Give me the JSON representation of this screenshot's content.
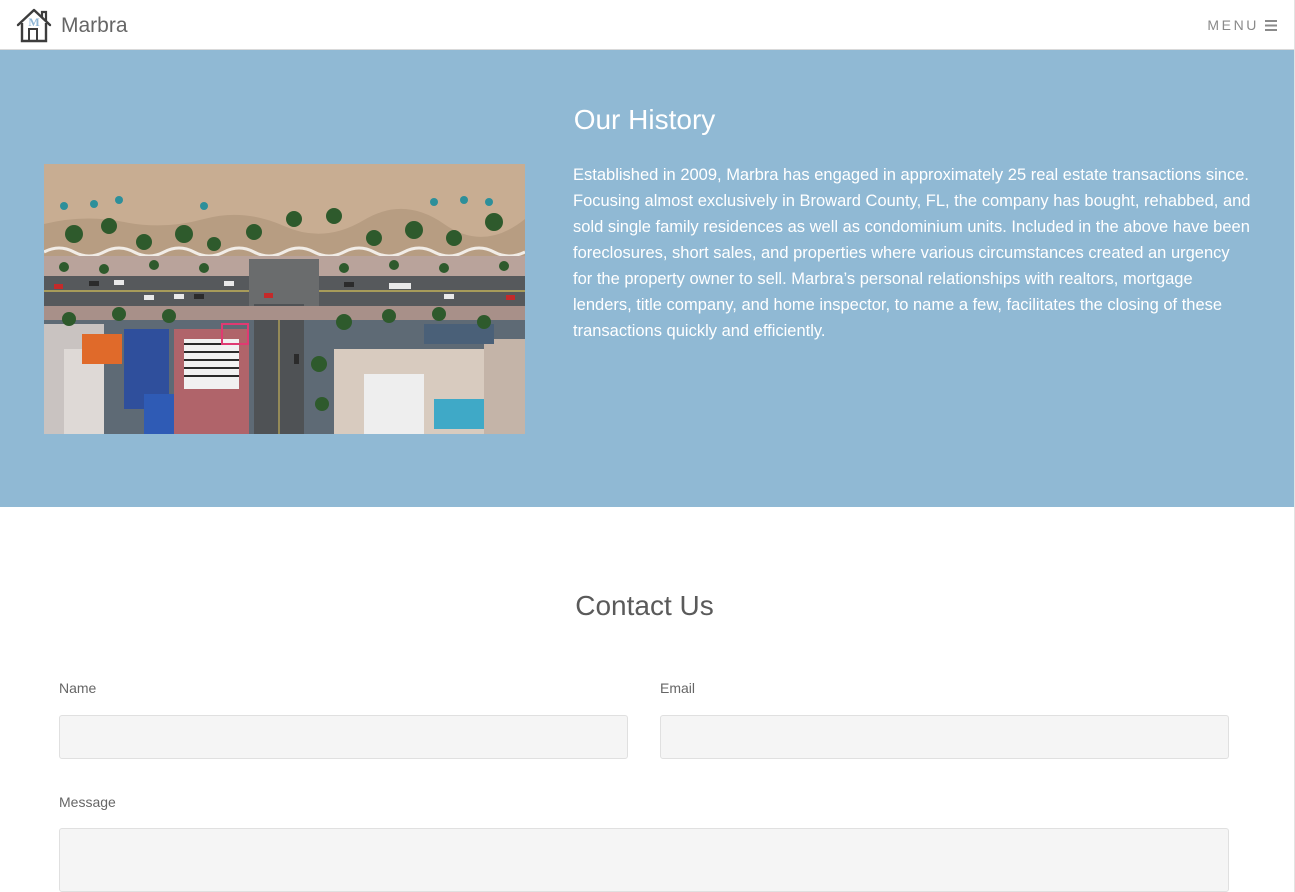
{
  "header": {
    "brand_name": "Marbra",
    "logo_letter": "M",
    "menu_label": "MENU",
    "menu_icon": "hamburger-icon"
  },
  "history": {
    "title": "Our History",
    "image_subject": "aerial-beachfront-street-photo",
    "body": "Established in 2009, Marbra has engaged in approximately 25 real estate transactions since. Focusing almost exclusively in Broward County, FL, the company has bought, rehabbed, and sold single family residences as well as condominium units. Included in the above have been foreclosures, short sales, and properties where various circumstances created an urgency for the property owner to sell. Marbra’s personal relationships with realtors, mortgage lenders, title company, and home inspector, to name a few, facilitates the closing of these transactions quickly and efficiently."
  },
  "contact": {
    "title": "Contact Us",
    "name_label": "Name",
    "name_value": "",
    "name_placeholder": "",
    "email_label": "Email",
    "email_value": "",
    "email_placeholder": "",
    "message_label": "Message",
    "message_value": "",
    "message_placeholder": ""
  },
  "colors": {
    "history_background": "#90b9d4",
    "logo_accent": "#8fb6d6",
    "input_background": "#f5f5f5"
  }
}
